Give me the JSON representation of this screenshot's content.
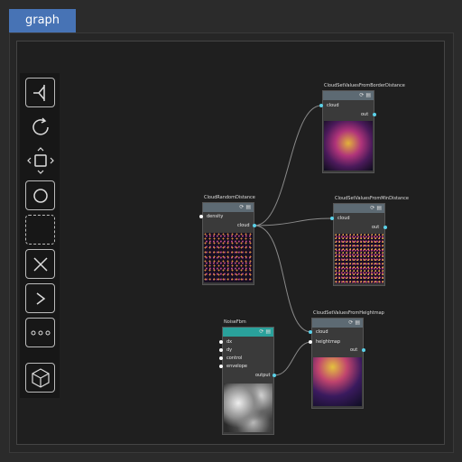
{
  "tab": {
    "label": "graph"
  },
  "toolbar": {
    "tools": [
      {
        "name": "branch-icon"
      },
      {
        "name": "refresh-icon"
      },
      {
        "name": "move-icon"
      },
      {
        "name": "circle-icon"
      },
      {
        "name": "dashed-square-icon"
      },
      {
        "name": "close-icon"
      },
      {
        "name": "prompt-icon"
      },
      {
        "name": "more-icon"
      },
      {
        "name": "cube-icon"
      }
    ]
  },
  "nodes": {
    "border": {
      "title": "CloudSetValuesFromBorderDistance",
      "in1": "cloud",
      "out1": "out"
    },
    "random": {
      "title": "CloudRandomDistance",
      "in1": "density",
      "out1": "cloud"
    },
    "min": {
      "title": "CloudSetValuesFromMinDistance",
      "in1": "cloud",
      "out1": "out"
    },
    "height": {
      "title": "CloudSetValuesFromHeightmap",
      "in1": "cloud",
      "in2": "heightmap",
      "out1": "out"
    },
    "noise": {
      "title": "NoiseFbm",
      "in1": "dx",
      "in2": "dy",
      "in3": "control",
      "in4": "envelope",
      "out1": "output"
    }
  },
  "colors": {
    "accent": "#4773b5",
    "port": "#5bd1e8",
    "noise_header": "#2aa19b"
  }
}
